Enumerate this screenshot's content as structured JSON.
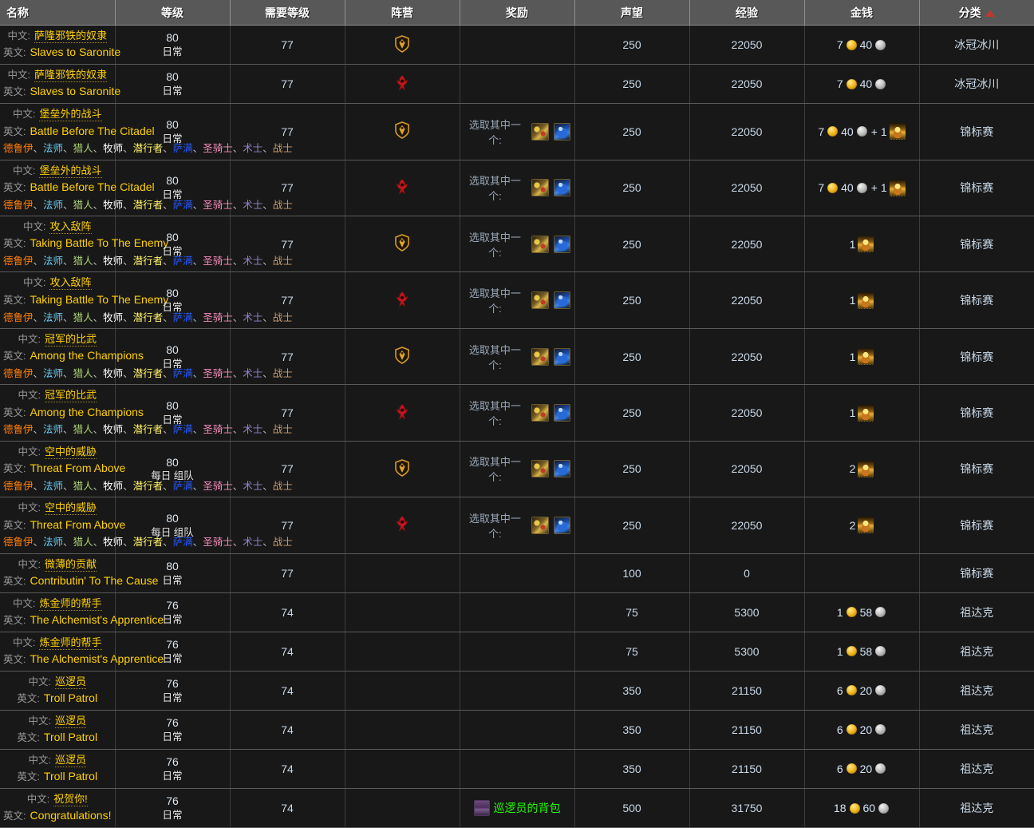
{
  "table": {
    "columns": [
      {
        "key": "name",
        "label": "名称",
        "sorted": false
      },
      {
        "key": "level",
        "label": "等级",
        "sorted": false
      },
      {
        "key": "req",
        "label": "需要等级",
        "sorted": false
      },
      {
        "key": "faction",
        "label": "阵营",
        "sorted": false
      },
      {
        "key": "reward",
        "label": "奖励",
        "sorted": false
      },
      {
        "key": "rep",
        "label": "声望",
        "sorted": false
      },
      {
        "key": "exp",
        "label": "经验",
        "sorted": false
      },
      {
        "key": "money",
        "label": "金钱",
        "sorted": false
      },
      {
        "key": "cat",
        "label": "分类",
        "sorted": true,
        "sort_icon": "sort-asc-arrow-icon"
      }
    ],
    "labels": {
      "cn": "中文:",
      "en": "英文:",
      "choose_one": "选取其中一个:",
      "separator": "、"
    },
    "classes": [
      {
        "name": "德鲁伊",
        "color": "#ff7d0a"
      },
      {
        "name": "法师",
        "color": "#69ccf0"
      },
      {
        "name": "猎人",
        "color": "#abd473"
      },
      {
        "name": "牧师",
        "color": "#ffffff"
      },
      {
        "name": "潜行者",
        "color": "#fff569"
      },
      {
        "name": "萨满",
        "color": "#2459ff"
      },
      {
        "name": "圣骑士",
        "color": "#f58cba"
      },
      {
        "name": "术士",
        "color": "#9482c9"
      },
      {
        "name": "战士",
        "color": "#c79c6e"
      }
    ],
    "rows": [
      {
        "cn": "萨隆邪铁的奴隶",
        "en": "Slaves to Saronite",
        "classes": false,
        "level": "80",
        "level_tag": "日常",
        "req": "77",
        "faction": "alliance",
        "reward": {
          "type": "none"
        },
        "rep": "250",
        "exp": "22050",
        "money": {
          "gold": "7",
          "silver": "40",
          "seal": null
        },
        "cat": "冰冠冰川"
      },
      {
        "cn": "萨隆邪铁的奴隶",
        "en": "Slaves to Saronite",
        "classes": false,
        "level": "80",
        "level_tag": "日常",
        "req": "77",
        "faction": "horde",
        "reward": {
          "type": "none"
        },
        "rep": "250",
        "exp": "22050",
        "money": {
          "gold": "7",
          "silver": "40",
          "seal": null
        },
        "cat": "冰冠冰川"
      },
      {
        "cn": "堡垒外的战斗",
        "en": "Battle Before The Citadel",
        "classes": true,
        "level": "80",
        "level_tag": "日常",
        "req": "77",
        "faction": "alliance",
        "reward": {
          "type": "choice",
          "icons": [
            "scroll-item-icon",
            "potion-item-icon"
          ]
        },
        "rep": "250",
        "exp": "22050",
        "money": {
          "gold": "7",
          "silver": "40",
          "seal": "1"
        },
        "cat": "锦标赛"
      },
      {
        "cn": "堡垒外的战斗",
        "en": "Battle Before The Citadel",
        "classes": true,
        "level": "80",
        "level_tag": "日常",
        "req": "77",
        "faction": "horde",
        "reward": {
          "type": "choice",
          "icons": [
            "scroll-item-icon",
            "potion-item-icon"
          ]
        },
        "rep": "250",
        "exp": "22050",
        "money": {
          "gold": "7",
          "silver": "40",
          "seal": "1"
        },
        "cat": "锦标赛"
      },
      {
        "cn": "攻入敌阵",
        "en": "Taking Battle To The Enemy",
        "classes": true,
        "level": "80",
        "level_tag": "日常",
        "req": "77",
        "faction": "alliance",
        "reward": {
          "type": "choice",
          "icons": [
            "scroll-item-icon",
            "potion-item-icon"
          ]
        },
        "rep": "250",
        "exp": "22050",
        "money": {
          "gold": null,
          "silver": null,
          "seal": "1"
        },
        "cat": "锦标赛"
      },
      {
        "cn": "攻入敌阵",
        "en": "Taking Battle To The Enemy",
        "classes": true,
        "level": "80",
        "level_tag": "日常",
        "req": "77",
        "faction": "horde",
        "reward": {
          "type": "choice",
          "icons": [
            "scroll-item-icon",
            "potion-item-icon"
          ]
        },
        "rep": "250",
        "exp": "22050",
        "money": {
          "gold": null,
          "silver": null,
          "seal": "1"
        },
        "cat": "锦标赛"
      },
      {
        "cn": "冠军的比武",
        "en": "Among the Champions",
        "classes": true,
        "level": "80",
        "level_tag": "日常",
        "req": "77",
        "faction": "alliance",
        "reward": {
          "type": "choice",
          "icons": [
            "scroll-item-icon",
            "potion-item-icon"
          ]
        },
        "rep": "250",
        "exp": "22050",
        "money": {
          "gold": null,
          "silver": null,
          "seal": "1"
        },
        "cat": "锦标赛"
      },
      {
        "cn": "冠军的比武",
        "en": "Among the Champions",
        "classes": true,
        "level": "80",
        "level_tag": "日常",
        "req": "77",
        "faction": "horde",
        "reward": {
          "type": "choice",
          "icons": [
            "scroll-item-icon",
            "potion-item-icon"
          ]
        },
        "rep": "250",
        "exp": "22050",
        "money": {
          "gold": null,
          "silver": null,
          "seal": "1"
        },
        "cat": "锦标赛"
      },
      {
        "cn": "空中的威胁",
        "en": "Threat From Above",
        "classes": true,
        "level": "80",
        "level_tag": "每日 组队",
        "req": "77",
        "faction": "alliance",
        "reward": {
          "type": "choice",
          "icons": [
            "scroll-item-icon",
            "potion-item-icon"
          ]
        },
        "rep": "250",
        "exp": "22050",
        "money": {
          "gold": null,
          "silver": null,
          "seal": "2"
        },
        "cat": "锦标赛"
      },
      {
        "cn": "空中的威胁",
        "en": "Threat From Above",
        "classes": true,
        "level": "80",
        "level_tag": "每日 组队",
        "req": "77",
        "faction": "horde",
        "reward": {
          "type": "choice",
          "icons": [
            "scroll-item-icon",
            "potion-item-icon"
          ]
        },
        "rep": "250",
        "exp": "22050",
        "money": {
          "gold": null,
          "silver": null,
          "seal": "2"
        },
        "cat": "锦标赛"
      },
      {
        "cn": "微薄的贡献",
        "en": "Contributin' To The Cause",
        "classes": false,
        "level": "80",
        "level_tag": "日常",
        "req": "77",
        "faction": "none",
        "reward": {
          "type": "none"
        },
        "rep": "100",
        "exp": "0",
        "money": {
          "gold": null,
          "silver": null,
          "seal": null
        },
        "cat": "锦标赛"
      },
      {
        "cn": "炼金师的帮手",
        "en": "The Alchemist's Apprentice",
        "classes": false,
        "level": "76",
        "level_tag": "日常",
        "req": "74",
        "faction": "none",
        "reward": {
          "type": "none"
        },
        "rep": "75",
        "exp": "5300",
        "money": {
          "gold": "1",
          "silver": "58",
          "seal": null
        },
        "cat": "祖达克"
      },
      {
        "cn": "炼金师的帮手",
        "en": "The Alchemist's Apprentice",
        "classes": false,
        "level": "76",
        "level_tag": "日常",
        "req": "74",
        "faction": "none",
        "reward": {
          "type": "none"
        },
        "rep": "75",
        "exp": "5300",
        "money": {
          "gold": "1",
          "silver": "58",
          "seal": null
        },
        "cat": "祖达克"
      },
      {
        "cn": "巡逻员",
        "en": "Troll Patrol",
        "classes": false,
        "level": "76",
        "level_tag": "日常",
        "req": "74",
        "faction": "none",
        "reward": {
          "type": "none"
        },
        "rep": "350",
        "exp": "21150",
        "money": {
          "gold": "6",
          "silver": "20",
          "seal": null
        },
        "cat": "祖达克"
      },
      {
        "cn": "巡逻员",
        "en": "Troll Patrol",
        "classes": false,
        "level": "76",
        "level_tag": "日常",
        "req": "74",
        "faction": "none",
        "reward": {
          "type": "none"
        },
        "rep": "350",
        "exp": "21150",
        "money": {
          "gold": "6",
          "silver": "20",
          "seal": null
        },
        "cat": "祖达克"
      },
      {
        "cn": "巡逻员",
        "en": "Troll Patrol",
        "classes": false,
        "level": "76",
        "level_tag": "日常",
        "req": "74",
        "faction": "none",
        "reward": {
          "type": "none"
        },
        "rep": "350",
        "exp": "21150",
        "money": {
          "gold": "6",
          "silver": "20",
          "seal": null
        },
        "cat": "祖达克"
      },
      {
        "cn": "祝贺你!",
        "en": "Congratulations!",
        "classes": false,
        "level": "76",
        "level_tag": "日常",
        "req": "74",
        "faction": "none",
        "reward": {
          "type": "item",
          "item_name": "巡逻员的背包",
          "item_icon": "bag-item-icon"
        },
        "rep": "500",
        "exp": "31750",
        "money": {
          "gold": "18",
          "silver": "60",
          "seal": null
        },
        "cat": "祖达克"
      }
    ]
  },
  "colors": {
    "quest_link": "#ffd100",
    "item_uncommon": "#1eff00",
    "header_bg": "#585858",
    "row_bg": "#181818",
    "sort_arrow": "#c0392b"
  }
}
